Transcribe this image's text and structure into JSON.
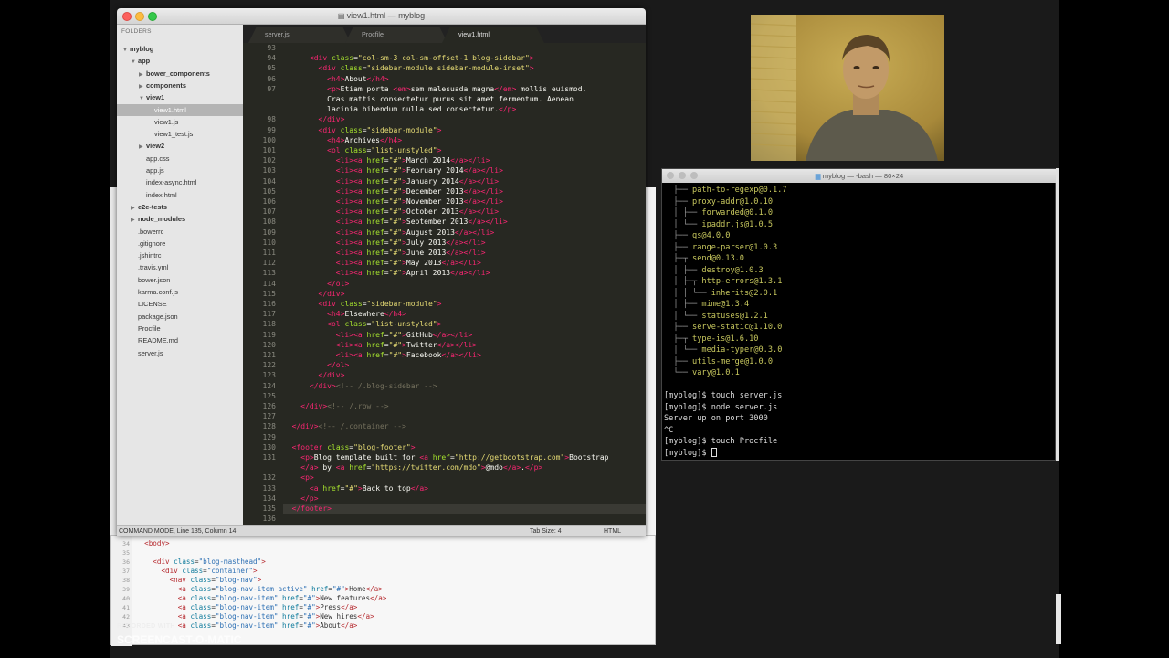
{
  "editor": {
    "title": "view1.html — myblog",
    "folders_header": "FOLDERS",
    "tree": [
      {
        "label": "myblog",
        "depth": 0,
        "open": true,
        "bold": true
      },
      {
        "label": "app",
        "depth": 1,
        "open": true,
        "bold": true
      },
      {
        "label": "bower_components",
        "depth": 2,
        "open": false,
        "bold": true
      },
      {
        "label": "components",
        "depth": 2,
        "open": false,
        "bold": true
      },
      {
        "label": "view1",
        "depth": 2,
        "open": true,
        "bold": true
      },
      {
        "label": "view1.html",
        "depth": 3,
        "selected": true
      },
      {
        "label": "view1.js",
        "depth": 3
      },
      {
        "label": "view1_test.js",
        "depth": 3
      },
      {
        "label": "view2",
        "depth": 2,
        "open": false,
        "bold": true
      },
      {
        "label": "app.css",
        "depth": 2
      },
      {
        "label": "app.js",
        "depth": 2
      },
      {
        "label": "index-async.html",
        "depth": 2
      },
      {
        "label": "index.html",
        "depth": 2
      },
      {
        "label": "e2e-tests",
        "depth": 1,
        "open": false,
        "bold": true
      },
      {
        "label": "node_modules",
        "depth": 1,
        "open": false,
        "bold": true
      },
      {
        "label": ".bowerrc",
        "depth": 1
      },
      {
        "label": ".gitignore",
        "depth": 1
      },
      {
        "label": ".jshintrc",
        "depth": 1
      },
      {
        "label": ".travis.yml",
        "depth": 1
      },
      {
        "label": "bower.json",
        "depth": 1
      },
      {
        "label": "karma.conf.js",
        "depth": 1
      },
      {
        "label": "LICENSE",
        "depth": 1
      },
      {
        "label": "package.json",
        "depth": 1
      },
      {
        "label": "Procfile",
        "depth": 1
      },
      {
        "label": "README.md",
        "depth": 1
      },
      {
        "label": "server.js",
        "depth": 1
      }
    ],
    "tabs": [
      "server.js",
      "Procfile",
      "view1.html"
    ],
    "active_tab": 2,
    "lines": [
      {
        "n": "93",
        "html": ""
      },
      {
        "n": "94",
        "html": "      <span class='t'>&lt;div</span> <span class='a'>class</span>=<span class='s'>\"col-sm-3 col-sm-offset-1 blog-sidebar\"</span><span class='t'>&gt;</span>"
      },
      {
        "n": "95",
        "html": "        <span class='t'>&lt;div</span> <span class='a'>class</span>=<span class='s'>\"sidebar-module sidebar-module-inset\"</span><span class='t'>&gt;</span>"
      },
      {
        "n": "96",
        "html": "          <span class='t'>&lt;h4&gt;</span>About<span class='t'>&lt;/h4&gt;</span>"
      },
      {
        "n": "97",
        "html": "          <span class='t'>&lt;p&gt;</span>Etiam porta <span class='t'>&lt;em&gt;</span>sem malesuada magna<span class='t'>&lt;/em&gt;</span> mollis euismod."
      },
      {
        "n": "",
        "html": "          Cras mattis consectetur purus sit amet fermentum. Aenean"
      },
      {
        "n": "",
        "html": "          lacinia bibendum nulla sed consectetur.<span class='t'>&lt;/p&gt;</span>"
      },
      {
        "n": "98",
        "html": "        <span class='t'>&lt;/div&gt;</span>"
      },
      {
        "n": "99",
        "html": "        <span class='t'>&lt;div</span> <span class='a'>class</span>=<span class='s'>\"sidebar-module\"</span><span class='t'>&gt;</span>"
      },
      {
        "n": "100",
        "html": "          <span class='t'>&lt;h4&gt;</span>Archives<span class='t'>&lt;/h4&gt;</span>"
      },
      {
        "n": "101",
        "html": "          <span class='t'>&lt;ol</span> <span class='a'>class</span>=<span class='s'>\"list-unstyled\"</span><span class='t'>&gt;</span>"
      },
      {
        "n": "102",
        "html": "            <span class='t'>&lt;li&gt;&lt;a</span> <span class='a'>href</span>=<span class='s'>\"#\"</span><span class='t'>&gt;</span>March 2014<span class='t'>&lt;/a&gt;&lt;/li&gt;</span>"
      },
      {
        "n": "103",
        "html": "            <span class='t'>&lt;li&gt;&lt;a</span> <span class='a'>href</span>=<span class='s'>\"#\"</span><span class='t'>&gt;</span>February 2014<span class='t'>&lt;/a&gt;&lt;/li&gt;</span>"
      },
      {
        "n": "104",
        "html": "            <span class='t'>&lt;li&gt;&lt;a</span> <span class='a'>href</span>=<span class='s'>\"#\"</span><span class='t'>&gt;</span>January 2014<span class='t'>&lt;/a&gt;&lt;/li&gt;</span>"
      },
      {
        "n": "105",
        "html": "            <span class='t'>&lt;li&gt;&lt;a</span> <span class='a'>href</span>=<span class='s'>\"#\"</span><span class='t'>&gt;</span>December 2013<span class='t'>&lt;/a&gt;&lt;/li&gt;</span>"
      },
      {
        "n": "106",
        "html": "            <span class='t'>&lt;li&gt;&lt;a</span> <span class='a'>href</span>=<span class='s'>\"#\"</span><span class='t'>&gt;</span>November 2013<span class='t'>&lt;/a&gt;&lt;/li&gt;</span>"
      },
      {
        "n": "107",
        "html": "            <span class='t'>&lt;li&gt;&lt;a</span> <span class='a'>href</span>=<span class='s'>\"#\"</span><span class='t'>&gt;</span>October 2013<span class='t'>&lt;/a&gt;&lt;/li&gt;</span>"
      },
      {
        "n": "108",
        "html": "            <span class='t'>&lt;li&gt;&lt;a</span> <span class='a'>href</span>=<span class='s'>\"#\"</span><span class='t'>&gt;</span>September 2013<span class='t'>&lt;/a&gt;&lt;/li&gt;</span>"
      },
      {
        "n": "109",
        "html": "            <span class='t'>&lt;li&gt;&lt;a</span> <span class='a'>href</span>=<span class='s'>\"#\"</span><span class='t'>&gt;</span>August 2013<span class='t'>&lt;/a&gt;&lt;/li&gt;</span>"
      },
      {
        "n": "110",
        "html": "            <span class='t'>&lt;li&gt;&lt;a</span> <span class='a'>href</span>=<span class='s'>\"#\"</span><span class='t'>&gt;</span>July 2013<span class='t'>&lt;/a&gt;&lt;/li&gt;</span>"
      },
      {
        "n": "111",
        "html": "            <span class='t'>&lt;li&gt;&lt;a</span> <span class='a'>href</span>=<span class='s'>\"#\"</span><span class='t'>&gt;</span>June 2013<span class='t'>&lt;/a&gt;&lt;/li&gt;</span>"
      },
      {
        "n": "112",
        "html": "            <span class='t'>&lt;li&gt;&lt;a</span> <span class='a'>href</span>=<span class='s'>\"#\"</span><span class='t'>&gt;</span>May 2013<span class='t'>&lt;/a&gt;&lt;/li&gt;</span>"
      },
      {
        "n": "113",
        "html": "            <span class='t'>&lt;li&gt;&lt;a</span> <span class='a'>href</span>=<span class='s'>\"#\"</span><span class='t'>&gt;</span>April 2013<span class='t'>&lt;/a&gt;&lt;/li&gt;</span>"
      },
      {
        "n": "114",
        "html": "          <span class='t'>&lt;/ol&gt;</span>"
      },
      {
        "n": "115",
        "html": "        <span class='t'>&lt;/div&gt;</span>"
      },
      {
        "n": "116",
        "html": "        <span class='t'>&lt;div</span> <span class='a'>class</span>=<span class='s'>\"sidebar-module\"</span><span class='t'>&gt;</span>"
      },
      {
        "n": "117",
        "html": "          <span class='t'>&lt;h4&gt;</span>Elsewhere<span class='t'>&lt;/h4&gt;</span>"
      },
      {
        "n": "118",
        "html": "          <span class='t'>&lt;ol</span> <span class='a'>class</span>=<span class='s'>\"list-unstyled\"</span><span class='t'>&gt;</span>"
      },
      {
        "n": "119",
        "html": "            <span class='t'>&lt;li&gt;&lt;a</span> <span class='a'>href</span>=<span class='s'>\"#\"</span><span class='t'>&gt;</span>GitHub<span class='t'>&lt;/a&gt;&lt;/li&gt;</span>"
      },
      {
        "n": "120",
        "html": "            <span class='t'>&lt;li&gt;&lt;a</span> <span class='a'>href</span>=<span class='s'>\"#\"</span><span class='t'>&gt;</span>Twitter<span class='t'>&lt;/a&gt;&lt;/li&gt;</span>"
      },
      {
        "n": "121",
        "html": "            <span class='t'>&lt;li&gt;&lt;a</span> <span class='a'>href</span>=<span class='s'>\"#\"</span><span class='t'>&gt;</span>Facebook<span class='t'>&lt;/a&gt;&lt;/li&gt;</span>"
      },
      {
        "n": "122",
        "html": "          <span class='t'>&lt;/ol&gt;</span>"
      },
      {
        "n": "123",
        "html": "        <span class='t'>&lt;/div&gt;</span>"
      },
      {
        "n": "124",
        "html": "      <span class='t'>&lt;/div&gt;</span><span class='c'>&lt;!-- /.blog-sidebar --&gt;</span>"
      },
      {
        "n": "125",
        "html": ""
      },
      {
        "n": "126",
        "html": "    <span class='t'>&lt;/div&gt;</span><span class='c'>&lt;!-- /.row --&gt;</span>"
      },
      {
        "n": "127",
        "html": ""
      },
      {
        "n": "128",
        "html": "  <span class='t'>&lt;/div&gt;</span><span class='c'>&lt;!-- /.container --&gt;</span>"
      },
      {
        "n": "129",
        "html": ""
      },
      {
        "n": "130",
        "html": "  <span class='t'>&lt;footer</span> <span class='a'>class</span>=<span class='s'>\"blog-footer\"</span><span class='t'>&gt;</span>"
      },
      {
        "n": "131",
        "html": "    <span class='t'>&lt;p&gt;</span>Blog template built for <span class='t'>&lt;a</span> <span class='a'>href</span>=<span class='s'>\"http://getbootstrap.com\"</span><span class='t'>&gt;</span>Bootstrap"
      },
      {
        "n": "",
        "html": "    <span class='t'>&lt;/a&gt;</span> by <span class='t'>&lt;a</span> <span class='a'>href</span>=<span class='s'>\"https://twitter.com/mdo\"</span><span class='t'>&gt;</span>@mdo<span class='t'>&lt;/a&gt;</span>.<span class='t'>&lt;/p&gt;</span>"
      },
      {
        "n": "132",
        "html": "    <span class='t'>&lt;p&gt;</span>"
      },
      {
        "n": "133",
        "html": "      <span class='t'>&lt;a</span> <span class='a'>href</span>=<span class='s'>\"#\"</span><span class='t'>&gt;</span>Back to top<span class='t'>&lt;/a&gt;</span>"
      },
      {
        "n": "134",
        "html": "    <span class='t'>&lt;/p&gt;</span>"
      },
      {
        "n": "135",
        "html": "  <span class='t'>&lt;/footer&gt;</span>",
        "highlight": true
      },
      {
        "n": "136",
        "html": ""
      }
    ],
    "status": {
      "mode": "COMMAND MODE, Line 135, Column 14",
      "tab_size": "Tab Size: 4",
      "syntax": "HTML"
    }
  },
  "terminal": {
    "title": "myblog — -bash — 80×24",
    "lines": [
      {
        "tree": "  ├── ",
        "pkg": "path-to-regexp@0.1.7"
      },
      {
        "tree": "  ├── ",
        "pkg": "proxy-addr@1.0.10"
      },
      {
        "tree": "  │ ├── ",
        "pkg": "forwarded@0.1.0"
      },
      {
        "tree": "  │ └── ",
        "pkg": "ipaddr.js@1.0.5"
      },
      {
        "tree": "  ├── ",
        "pkg": "qs@4.0.0"
      },
      {
        "tree": "  ├── ",
        "pkg": "range-parser@1.0.3"
      },
      {
        "tree": "  ├─┬ ",
        "pkg": "send@0.13.0"
      },
      {
        "tree": "  │ ├── ",
        "pkg": "destroy@1.0.3"
      },
      {
        "tree": "  │ ├─┬ ",
        "pkg": "http-errors@1.3.1"
      },
      {
        "tree": "  │ │ └── ",
        "pkg": "inherits@2.0.1"
      },
      {
        "tree": "  │ ├── ",
        "pkg": "mime@1.3.4"
      },
      {
        "tree": "  │ └── ",
        "pkg": "statuses@1.2.1"
      },
      {
        "tree": "  ├── ",
        "pkg": "serve-static@1.10.0"
      },
      {
        "tree": "  ├─┬ ",
        "pkg": "type-is@1.6.10"
      },
      {
        "tree": "  │ └── ",
        "pkg": "media-typer@0.3.0"
      },
      {
        "tree": "  ├── ",
        "pkg": "utils-merge@1.0.0"
      },
      {
        "tree": "  └── ",
        "pkg": "vary@1.0.1"
      },
      {
        "tree": "",
        "pkg": ""
      },
      {
        "text": "[myblog]$ touch server.js"
      },
      {
        "text": "[myblog]$ node server.js"
      },
      {
        "text": "Server up on port 3000"
      },
      {
        "text": "^C"
      },
      {
        "text": "[myblog]$ touch Procfile"
      },
      {
        "text": "[myblog]$ ",
        "cursor": true
      }
    ]
  },
  "background_code": {
    "gutter": [
      "34",
      "35",
      "36",
      "37",
      "38",
      "39",
      "40",
      "41",
      "42",
      "43"
    ],
    "lines": [
      "  <span class='bt'>&lt;body&gt;</span>",
      "",
      "    <span class='bt'>&lt;div</span> <span class='ba'>class</span>=<span class='bs'>\"blog-masthead\"</span><span class='bt'>&gt;</span>",
      "      <span class='bt'>&lt;div</span> <span class='ba'>class</span>=<span class='bs'>\"container\"</span><span class='bt'>&gt;</span>",
      "        <span class='bt'>&lt;nav</span> <span class='ba'>class</span>=<span class='bs'>\"blog-nav\"</span><span class='bt'>&gt;</span>",
      "          <span class='bt'>&lt;a</span> <span class='ba'>class</span>=<span class='bs'>\"blog-nav-item active\"</span> <span class='ba'>href</span>=<span class='bs'>\"#\"</span><span class='bt'>&gt;</span>Home<span class='bt'>&lt;/a&gt;</span>",
      "          <span class='bt'>&lt;a</span> <span class='ba'>class</span>=<span class='bs'>\"blog-nav-item\"</span> <span class='ba'>href</span>=<span class='bs'>\"#\"</span><span class='bt'>&gt;</span>New features<span class='bt'>&lt;/a&gt;</span>",
      "          <span class='bt'>&lt;a</span> <span class='ba'>class</span>=<span class='bs'>\"blog-nav-item\"</span> <span class='ba'>href</span>=<span class='bs'>\"#\"</span><span class='bt'>&gt;</span>Press<span class='bt'>&lt;/a&gt;</span>",
      "          <span class='bt'>&lt;a</span> <span class='ba'>class</span>=<span class='bs'>\"blog-nav-item\"</span> <span class='ba'>href</span>=<span class='bs'>\"#\"</span><span class='bt'>&gt;</span>New hires<span class='bt'>&lt;/a&gt;</span>",
      "          <span class='bt'>&lt;a</span> <span class='ba'>class</span>=<span class='bs'>\"blog-nav-item\"</span> <span class='ba'>href</span>=<span class='bs'>\"#\"</span><span class='bt'>&gt;</span>About<span class='bt'>&lt;/a&gt;</span>"
    ]
  },
  "watermark": {
    "line1": "RECORDED WITH",
    "line2": "SCREENCAST-O-MATIC"
  },
  "colors": {
    "editor_bg": "#272822",
    "tag": "#f92672",
    "attr": "#a6e22e",
    "string": "#e6db74",
    "comment": "#75715e",
    "terminal_pkg": "#c8c85e"
  }
}
